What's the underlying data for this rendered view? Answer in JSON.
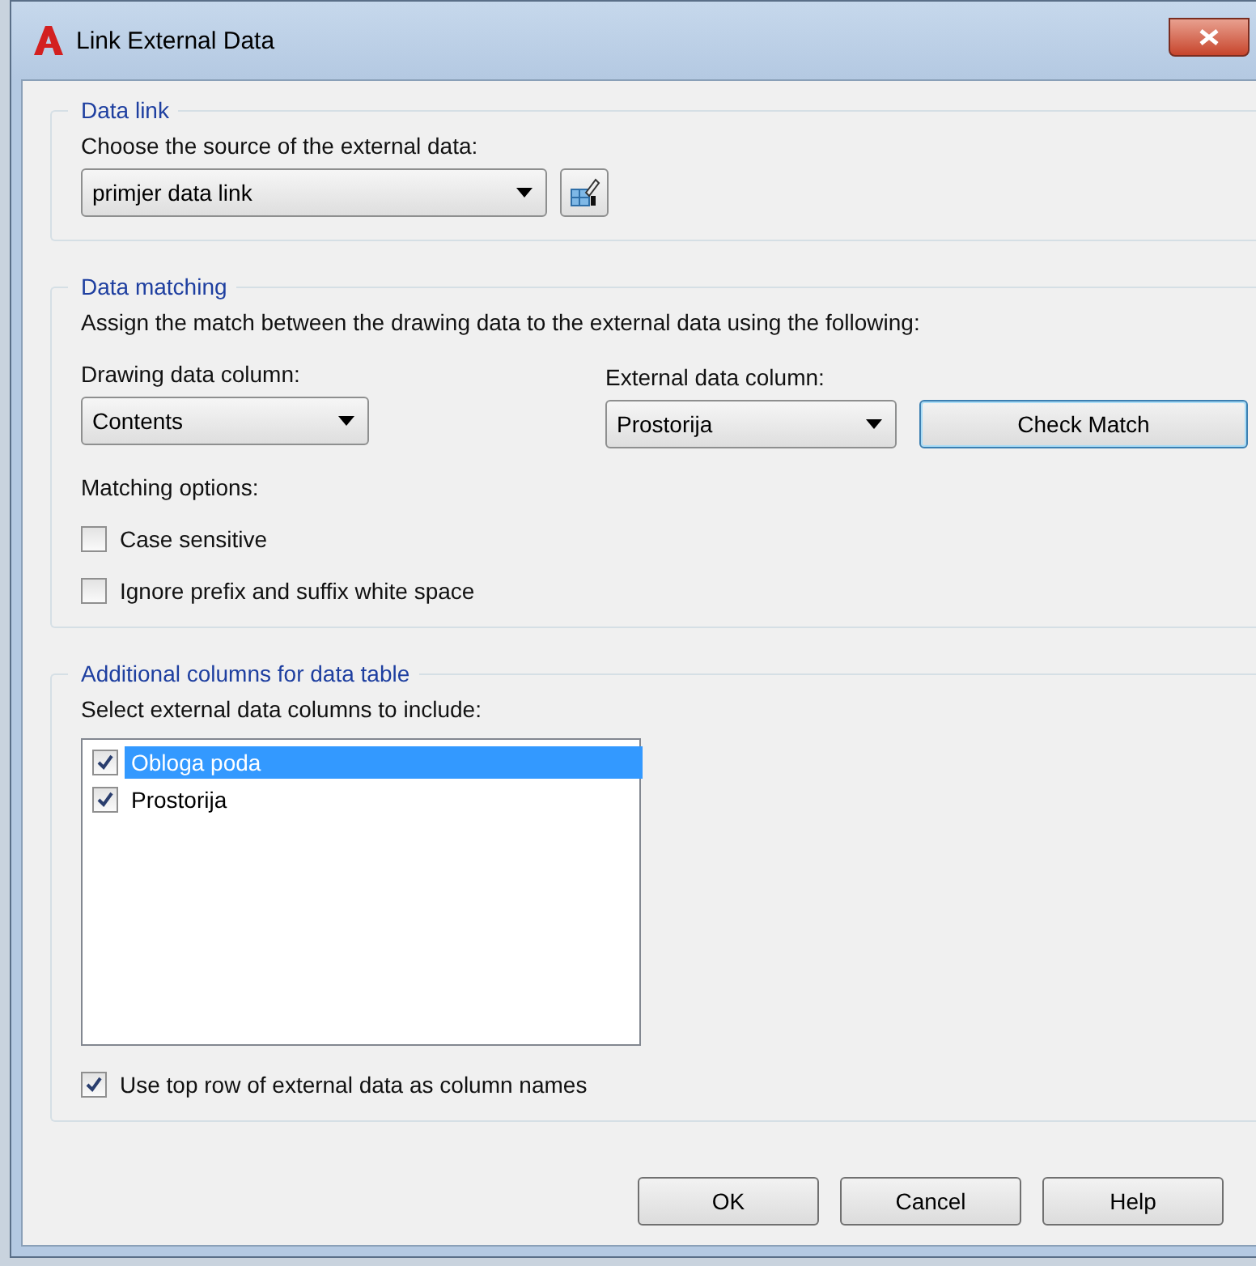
{
  "window": {
    "title": "Link External Data"
  },
  "data_link": {
    "title": "Data link",
    "label": "Choose the source of the external data:",
    "source": {
      "value": "primjer data link"
    }
  },
  "data_matching": {
    "title": "Data matching",
    "description": "Assign the match between the drawing data to the external data using the following:",
    "drawing_column": {
      "label": "Drawing data column:",
      "value": "Contents"
    },
    "external_column": {
      "label": "External data column:",
      "value": "Prostorija"
    },
    "check_button": "Check Match",
    "options_label": "Matching options:",
    "options": [
      {
        "label": "Case sensitive",
        "checked": false
      },
      {
        "label": "Ignore prefix and suffix white space",
        "checked": false
      }
    ]
  },
  "additional": {
    "title": "Additional columns for data table",
    "label": "Select external data columns to include:",
    "columns": [
      {
        "label": "Obloga poda",
        "checked": true,
        "selected": true
      },
      {
        "label": "Prostorija",
        "checked": true,
        "selected": false
      }
    ],
    "use_top_row": {
      "label": "Use top row of external data as column names",
      "checked": true
    }
  },
  "buttons": [
    "OK",
    "Cancel",
    "Help"
  ]
}
